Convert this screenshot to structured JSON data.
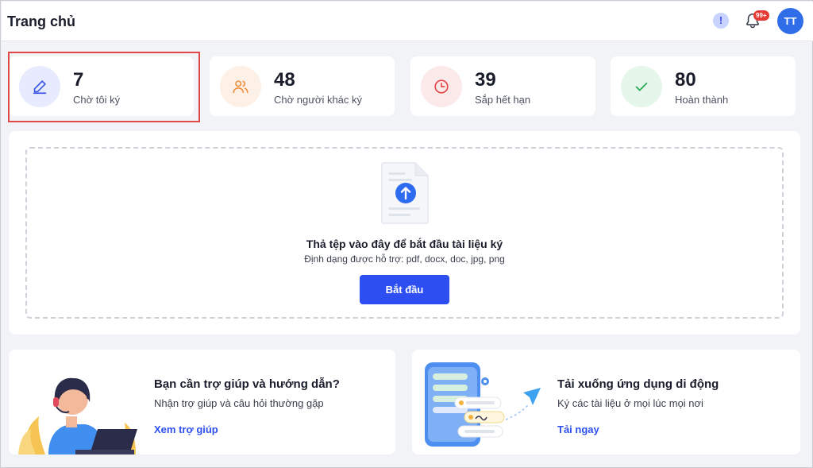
{
  "header": {
    "title": "Trang chủ",
    "help_icon": "!",
    "notification_badge": "99+",
    "avatar_initials": "TT"
  },
  "stats": [
    {
      "value": "7",
      "label": "Chờ tôi ký",
      "icon": "pen-icon",
      "color": "#3b55e6"
    },
    {
      "value": "48",
      "label": "Chờ người khác ký",
      "icon": "users-icon",
      "color": "#f08c3a"
    },
    {
      "value": "39",
      "label": "Sắp hết hạn",
      "icon": "clock-icon",
      "color": "#e04848"
    },
    {
      "value": "80",
      "label": "Hoàn thành",
      "icon": "check-icon",
      "color": "#2fae5a"
    }
  ],
  "upload": {
    "title": "Thả tệp vào đây để bắt đầu tài liệu ký",
    "formats": "Định dạng được hỗ trợ: pdf, docx, doc, jpg, png",
    "button": "Bắt đầu"
  },
  "help_card": {
    "title": "Bạn cần trợ giúp và hướng dẫn?",
    "description": "Nhận trợ giúp và câu hỏi thường gặp",
    "link": "Xem trợ giúp"
  },
  "app_card": {
    "title": "Tải xuống ứng dụng di động",
    "description": "Ký các tài liệu ở mọi lúc mọi nơi",
    "link": "Tải ngay"
  },
  "colors": {
    "primary": "#2d4ff2",
    "danger": "#e53935",
    "highlight_border": "#e04848"
  }
}
